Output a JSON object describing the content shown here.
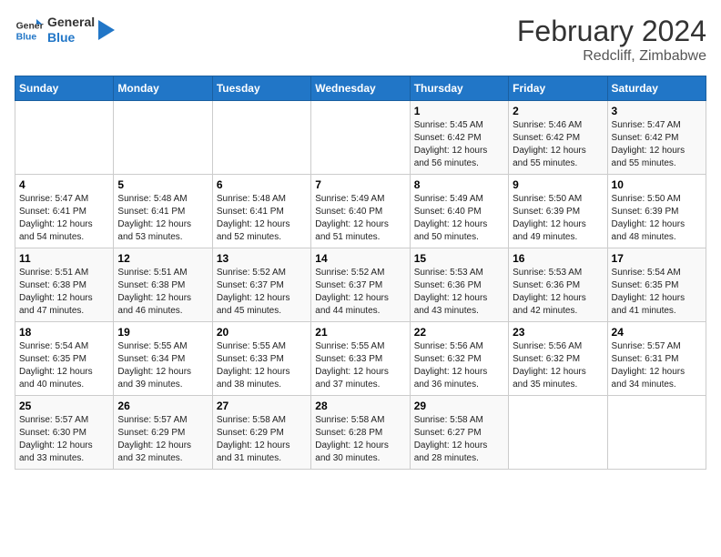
{
  "logo": {
    "line1": "General",
    "line2": "Blue"
  },
  "title": {
    "month_year": "February 2024",
    "location": "Redcliff, Zimbabwe"
  },
  "days_of_week": [
    "Sunday",
    "Monday",
    "Tuesday",
    "Wednesday",
    "Thursday",
    "Friday",
    "Saturday"
  ],
  "weeks": [
    [
      {
        "day": "",
        "info": ""
      },
      {
        "day": "",
        "info": ""
      },
      {
        "day": "",
        "info": ""
      },
      {
        "day": "",
        "info": ""
      },
      {
        "day": "1",
        "info": "Sunrise: 5:45 AM\nSunset: 6:42 PM\nDaylight: 12 hours\nand 56 minutes."
      },
      {
        "day": "2",
        "info": "Sunrise: 5:46 AM\nSunset: 6:42 PM\nDaylight: 12 hours\nand 55 minutes."
      },
      {
        "day": "3",
        "info": "Sunrise: 5:47 AM\nSunset: 6:42 PM\nDaylight: 12 hours\nand 55 minutes."
      }
    ],
    [
      {
        "day": "4",
        "info": "Sunrise: 5:47 AM\nSunset: 6:41 PM\nDaylight: 12 hours\nand 54 minutes."
      },
      {
        "day": "5",
        "info": "Sunrise: 5:48 AM\nSunset: 6:41 PM\nDaylight: 12 hours\nand 53 minutes."
      },
      {
        "day": "6",
        "info": "Sunrise: 5:48 AM\nSunset: 6:41 PM\nDaylight: 12 hours\nand 52 minutes."
      },
      {
        "day": "7",
        "info": "Sunrise: 5:49 AM\nSunset: 6:40 PM\nDaylight: 12 hours\nand 51 minutes."
      },
      {
        "day": "8",
        "info": "Sunrise: 5:49 AM\nSunset: 6:40 PM\nDaylight: 12 hours\nand 50 minutes."
      },
      {
        "day": "9",
        "info": "Sunrise: 5:50 AM\nSunset: 6:39 PM\nDaylight: 12 hours\nand 49 minutes."
      },
      {
        "day": "10",
        "info": "Sunrise: 5:50 AM\nSunset: 6:39 PM\nDaylight: 12 hours\nand 48 minutes."
      }
    ],
    [
      {
        "day": "11",
        "info": "Sunrise: 5:51 AM\nSunset: 6:38 PM\nDaylight: 12 hours\nand 47 minutes."
      },
      {
        "day": "12",
        "info": "Sunrise: 5:51 AM\nSunset: 6:38 PM\nDaylight: 12 hours\nand 46 minutes."
      },
      {
        "day": "13",
        "info": "Sunrise: 5:52 AM\nSunset: 6:37 PM\nDaylight: 12 hours\nand 45 minutes."
      },
      {
        "day": "14",
        "info": "Sunrise: 5:52 AM\nSunset: 6:37 PM\nDaylight: 12 hours\nand 44 minutes."
      },
      {
        "day": "15",
        "info": "Sunrise: 5:53 AM\nSunset: 6:36 PM\nDaylight: 12 hours\nand 43 minutes."
      },
      {
        "day": "16",
        "info": "Sunrise: 5:53 AM\nSunset: 6:36 PM\nDaylight: 12 hours\nand 42 minutes."
      },
      {
        "day": "17",
        "info": "Sunrise: 5:54 AM\nSunset: 6:35 PM\nDaylight: 12 hours\nand 41 minutes."
      }
    ],
    [
      {
        "day": "18",
        "info": "Sunrise: 5:54 AM\nSunset: 6:35 PM\nDaylight: 12 hours\nand 40 minutes."
      },
      {
        "day": "19",
        "info": "Sunrise: 5:55 AM\nSunset: 6:34 PM\nDaylight: 12 hours\nand 39 minutes."
      },
      {
        "day": "20",
        "info": "Sunrise: 5:55 AM\nSunset: 6:33 PM\nDaylight: 12 hours\nand 38 minutes."
      },
      {
        "day": "21",
        "info": "Sunrise: 5:55 AM\nSunset: 6:33 PM\nDaylight: 12 hours\nand 37 minutes."
      },
      {
        "day": "22",
        "info": "Sunrise: 5:56 AM\nSunset: 6:32 PM\nDaylight: 12 hours\nand 36 minutes."
      },
      {
        "day": "23",
        "info": "Sunrise: 5:56 AM\nSunset: 6:32 PM\nDaylight: 12 hours\nand 35 minutes."
      },
      {
        "day": "24",
        "info": "Sunrise: 5:57 AM\nSunset: 6:31 PM\nDaylight: 12 hours\nand 34 minutes."
      }
    ],
    [
      {
        "day": "25",
        "info": "Sunrise: 5:57 AM\nSunset: 6:30 PM\nDaylight: 12 hours\nand 33 minutes."
      },
      {
        "day": "26",
        "info": "Sunrise: 5:57 AM\nSunset: 6:29 PM\nDaylight: 12 hours\nand 32 minutes."
      },
      {
        "day": "27",
        "info": "Sunrise: 5:58 AM\nSunset: 6:29 PM\nDaylight: 12 hours\nand 31 minutes."
      },
      {
        "day": "28",
        "info": "Sunrise: 5:58 AM\nSunset: 6:28 PM\nDaylight: 12 hours\nand 30 minutes."
      },
      {
        "day": "29",
        "info": "Sunrise: 5:58 AM\nSunset: 6:27 PM\nDaylight: 12 hours\nand 28 minutes."
      },
      {
        "day": "",
        "info": ""
      },
      {
        "day": "",
        "info": ""
      }
    ]
  ]
}
